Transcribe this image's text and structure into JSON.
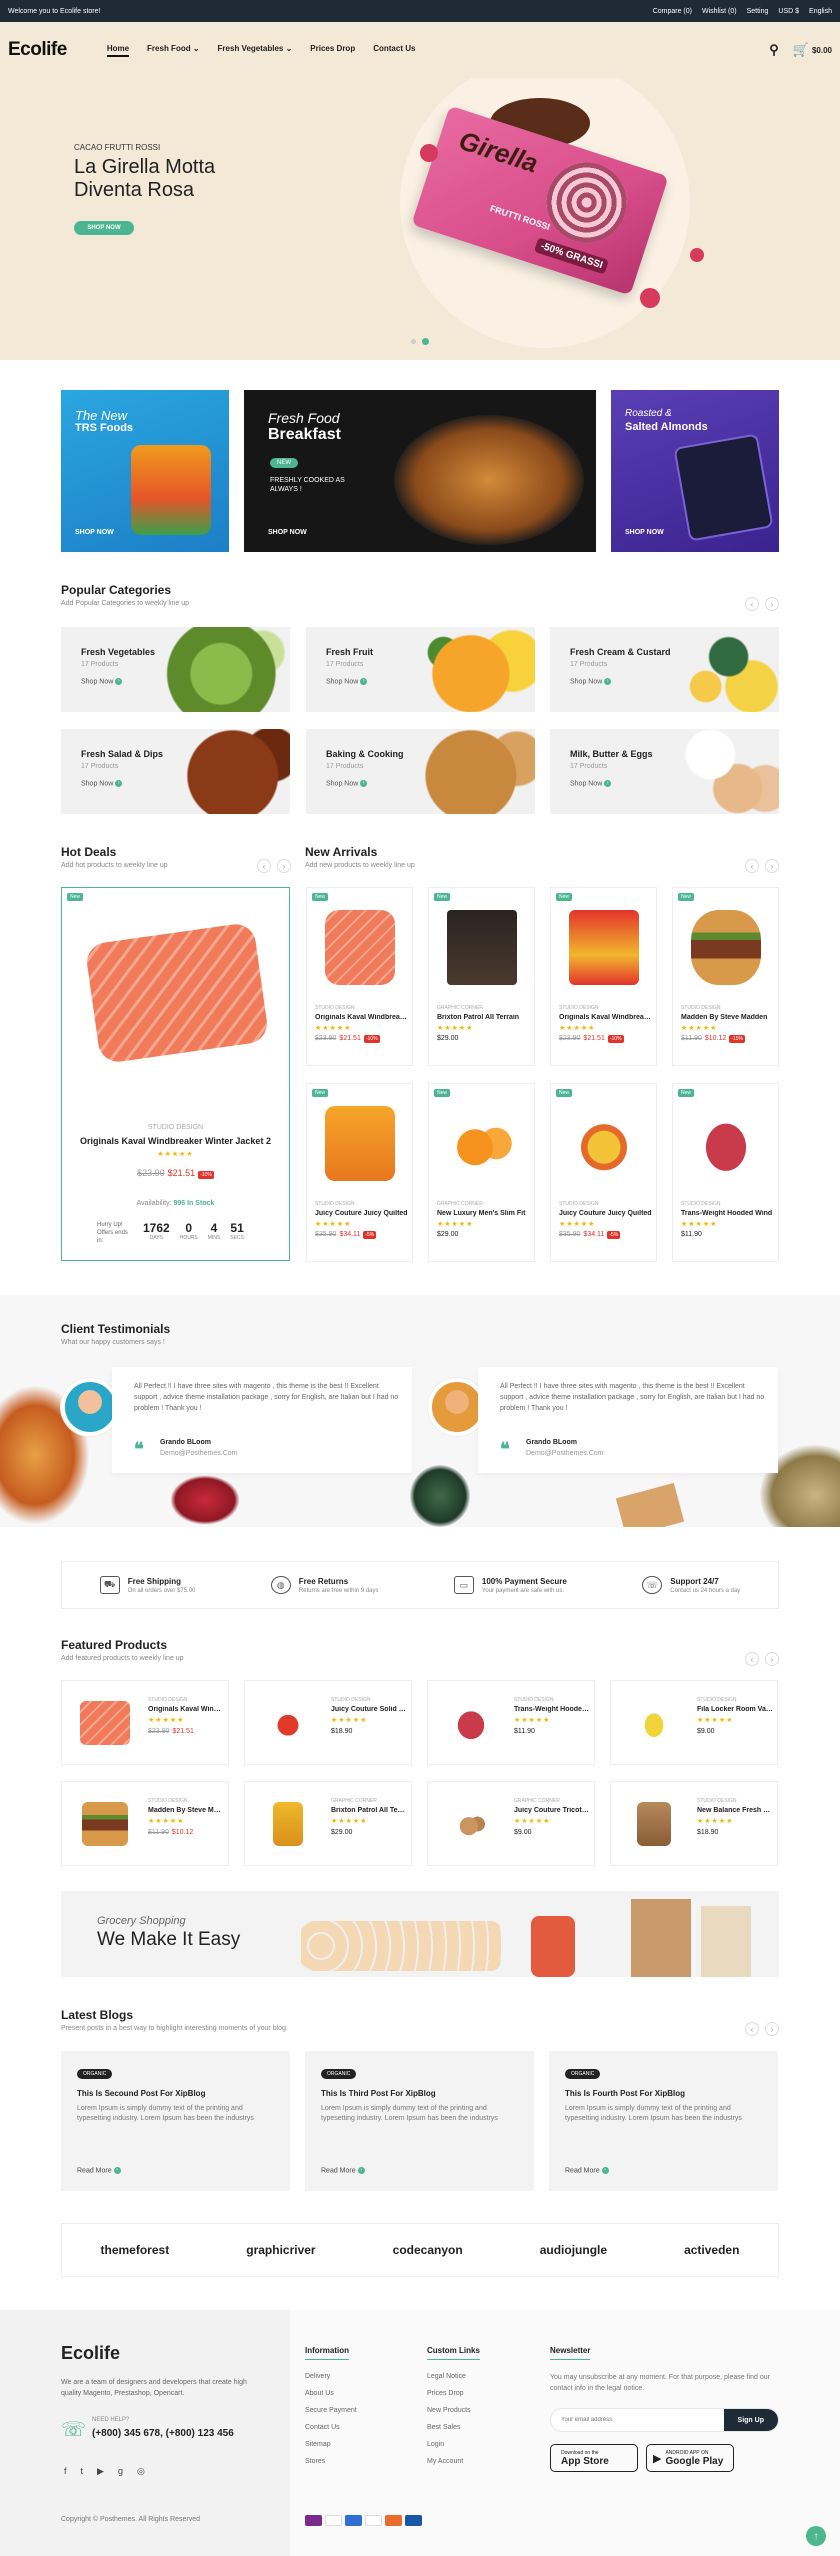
{
  "topbar": {
    "welcome": "Welcome you to Ecolife store!",
    "compare": "Compare (0)",
    "wishlist": "Wishlist (0)",
    "setting": "Setting",
    "currency": "USD $",
    "language": "English"
  },
  "header": {
    "logo": "Ecolife",
    "nav": [
      "Home",
      "Fresh Food",
      "Fresh Vegetables",
      "Prices Drop",
      "Contact Us"
    ],
    "cart_total": "$0.00",
    "cart_count": "0"
  },
  "hero": {
    "subtitle": "CACAO FRUTTI ROSSI",
    "title": "La Girella Motta Diventa Rosa",
    "button": "SHOP NOW",
    "pack_brand": "Girella",
    "pack_flavor": "FRUTTI ROSSI",
    "pack_promo": "-50% GRASSI"
  },
  "banners": [
    {
      "t1": "The New",
      "t2": "TRS Foods",
      "shop": "SHOP NOW"
    },
    {
      "t1": "Fresh Food",
      "t2": "Breakfast",
      "tag": "NEW",
      "desc": "FRESHLY COOKED AS ALWAYS !",
      "shop": "SHOP NOW"
    },
    {
      "t1": "Roasted &",
      "t2": "Salted Almonds",
      "shop": "SHOP NOW"
    }
  ],
  "popular": {
    "title": "Popular Categories",
    "subtitle": "Add Popular Categories to weekly line up",
    "shop": "Shop Now",
    "items": [
      {
        "name": "Fresh Vegetables",
        "count": "17 Products"
      },
      {
        "name": "Fresh Fruit",
        "count": "17 Products"
      },
      {
        "name": "Fresh Cream & Custard",
        "count": "17 Products"
      },
      {
        "name": "Fresh Salad & Dips",
        "count": "17 Products"
      },
      {
        "name": "Baking & Cooking",
        "count": "17 Products"
      },
      {
        "name": "Milk, Butter & Eggs",
        "count": "17 Products"
      }
    ]
  },
  "hotdeals": {
    "title": "Hot Deals",
    "subtitle": "Add hot products to weekly line up",
    "badge": "New",
    "brand": "STUDIO DESIGN",
    "name": "Originals Kaval Windbreaker Winter Jacket 2",
    "old": "$23.90",
    "new": "$21.51",
    "disc": "-10%",
    "availability_label": "Availability:",
    "availability": "996 In Stock",
    "hurry": "Hurry Up! Offers ends in:",
    "days": "1762",
    "hours": "0",
    "mins": "4",
    "secs": "51",
    "l_days": "DAYS",
    "l_hours": "HOURS",
    "l_mins": "MINS",
    "l_secs": "SECS"
  },
  "arrivals": {
    "title": "New Arrivals",
    "subtitle": "Add new products to weekly line up",
    "badge": "New",
    "items": [
      {
        "brand": "STUDIO DESIGN",
        "name": "Originals Kaval Windbreaker",
        "old": "$23.90",
        "new": "$21.51",
        "disc": "-10%"
      },
      {
        "brand": "GRAPHIC CORNER",
        "name": "Brixton Patrol All Terrain",
        "old": "",
        "new": "$29.00",
        "disc": ""
      },
      {
        "brand": "STUDIO DESIGN",
        "name": "Originals Kaval Windbreaker",
        "old": "$23.90",
        "new": "$21.51",
        "disc": "-10%"
      },
      {
        "brand": "STUDIO DESIGN",
        "name": "Madden By Steve Madden",
        "old": "$11.90",
        "new": "$10.12",
        "disc": "-15%"
      },
      {
        "brand": "STUDIO DESIGN",
        "name": "Juicy Couture Juicy Quilted",
        "old": "$35.90",
        "new": "$34.11",
        "disc": "-5%"
      },
      {
        "brand": "GRAPHIC CORNER",
        "name": "New Luxury Men's Slim Fit",
        "old": "",
        "new": "$29.00",
        "disc": ""
      },
      {
        "brand": "STUDIO DESIGN",
        "name": "Juicy Couture Juicy Quilted",
        "old": "$35.90",
        "new": "$34.11",
        "disc": "-5%"
      },
      {
        "brand": "STUDIO DESIGN",
        "name": "Trans-Weight Hooded Wind",
        "old": "",
        "new": "$11.90",
        "disc": ""
      }
    ]
  },
  "testimonials": {
    "title": "Client Testimonials",
    "subtitle": "What our happy customers says !",
    "items": [
      {
        "text": "All Perfect !! I have three sites with magento , this theme is the best !! Excellent support , advice theme installation package , sorry for English, are Italian but I had no problem ! Thank you !",
        "name": "Grando BLoom",
        "email": "Demo@Posthemes.Com"
      },
      {
        "text": "All Perfect !! I have three sites with magento , this theme is the best !! Excellent support , advice theme installation package , sorry for English, are Italian but I had no problem ! Thank you !",
        "name": "Grando BLoom",
        "email": "Demo@Posthemes.Com"
      }
    ]
  },
  "features": [
    {
      "a": "Free Shipping",
      "b": "On all orders over $75.00"
    },
    {
      "a": "Free Returns",
      "b": "Returns are free within 9 days"
    },
    {
      "a": "100% Payment Secure",
      "b": "Your payment are safe with us."
    },
    {
      "a": "Support 24/7",
      "b": "Contact us 24 hours a day"
    }
  ],
  "featured": {
    "title": "Featured Products",
    "subtitle": "Add featured products to weekly line up",
    "items": [
      {
        "brand": "STUDIO DESIGN",
        "name": "Originals Kaval Windbreaker",
        "old": "$23.90",
        "new": "$21.51"
      },
      {
        "brand": "STUDIO DESIGN",
        "name": "Juicy Couture Solid Sleeve",
        "old": "",
        "new": "$18.90"
      },
      {
        "brand": "STUDIO DESIGN",
        "name": "Trans-Weight Hooded Wind",
        "old": "",
        "new": "$11.90"
      },
      {
        "brand": "STUDIO DESIGN",
        "name": "Fila Locker Room Varsity",
        "old": "",
        "new": "$9.00"
      },
      {
        "brand": "STUDIO DESIGN",
        "name": "Madden By Steve Madden",
        "old": "$11.90",
        "new": "$10.12"
      },
      {
        "brand": "GRAPHIC CORNER",
        "name": "Brixton Patrol All Terrain",
        "old": "",
        "new": "$29.00"
      },
      {
        "brand": "GRAPHIC CORNER",
        "name": "Juicy Couture Tricot Logo",
        "old": "",
        "new": "$9.00"
      },
      {
        "brand": "STUDIO DESIGN",
        "name": "New Balance Fresh Foam",
        "old": "",
        "new": "$18.90"
      }
    ]
  },
  "grocery": {
    "t1": "Grocery Shopping",
    "t2": "We Make It Easy"
  },
  "blogs": {
    "title": "Latest Blogs",
    "subtitle": "Present posts in a best way to highlight interesting moments of your blog.",
    "tag": "ORGANIC",
    "readmore": "Read More",
    "body": "Lorem Ipsum is simply dummy text of the printing and typesetting industry. Lorem Ipsum has been the industrys",
    "items": [
      {
        "title": "This Is Secound Post For XipBlog"
      },
      {
        "title": "This Is Third Post For XipBlog"
      },
      {
        "title": "This Is Fourth Post For XipBlog"
      }
    ]
  },
  "brands": [
    "themeforest",
    "graphicriver",
    "codecanyon",
    "audiojungle",
    "activeden"
  ],
  "footer": {
    "logo": "Ecolife",
    "about": "We are a team of designers and developers that create high quality Magento, Prestashop, Opencart.",
    "need_help": "NEED HELP?",
    "phone": "(+800) 345 678, (+800) 123 456",
    "info_title": "Information",
    "info": [
      "Delivery",
      "About Us",
      "Secure Payment",
      "Contact Us",
      "Sitemap",
      "Stores"
    ],
    "links_title": "Custom Links",
    "links": [
      "Legal Notice",
      "Prices Drop",
      "New Products",
      "Best Sales",
      "Login",
      "My Account"
    ],
    "news_title": "Newsletter",
    "news_text": "You may unsubscribe at any moment. For that purpose, please find our contact info in the legal notice.",
    "email_ph": "Your email address",
    "signup": "Sign Up",
    "appstore_small": "Download on the",
    "appstore": "App Store",
    "gplay_small": "ANDROID APP ON",
    "gplay": "Google Play",
    "copyright": "Copyright © Posthemes. All Rights Reserved"
  }
}
